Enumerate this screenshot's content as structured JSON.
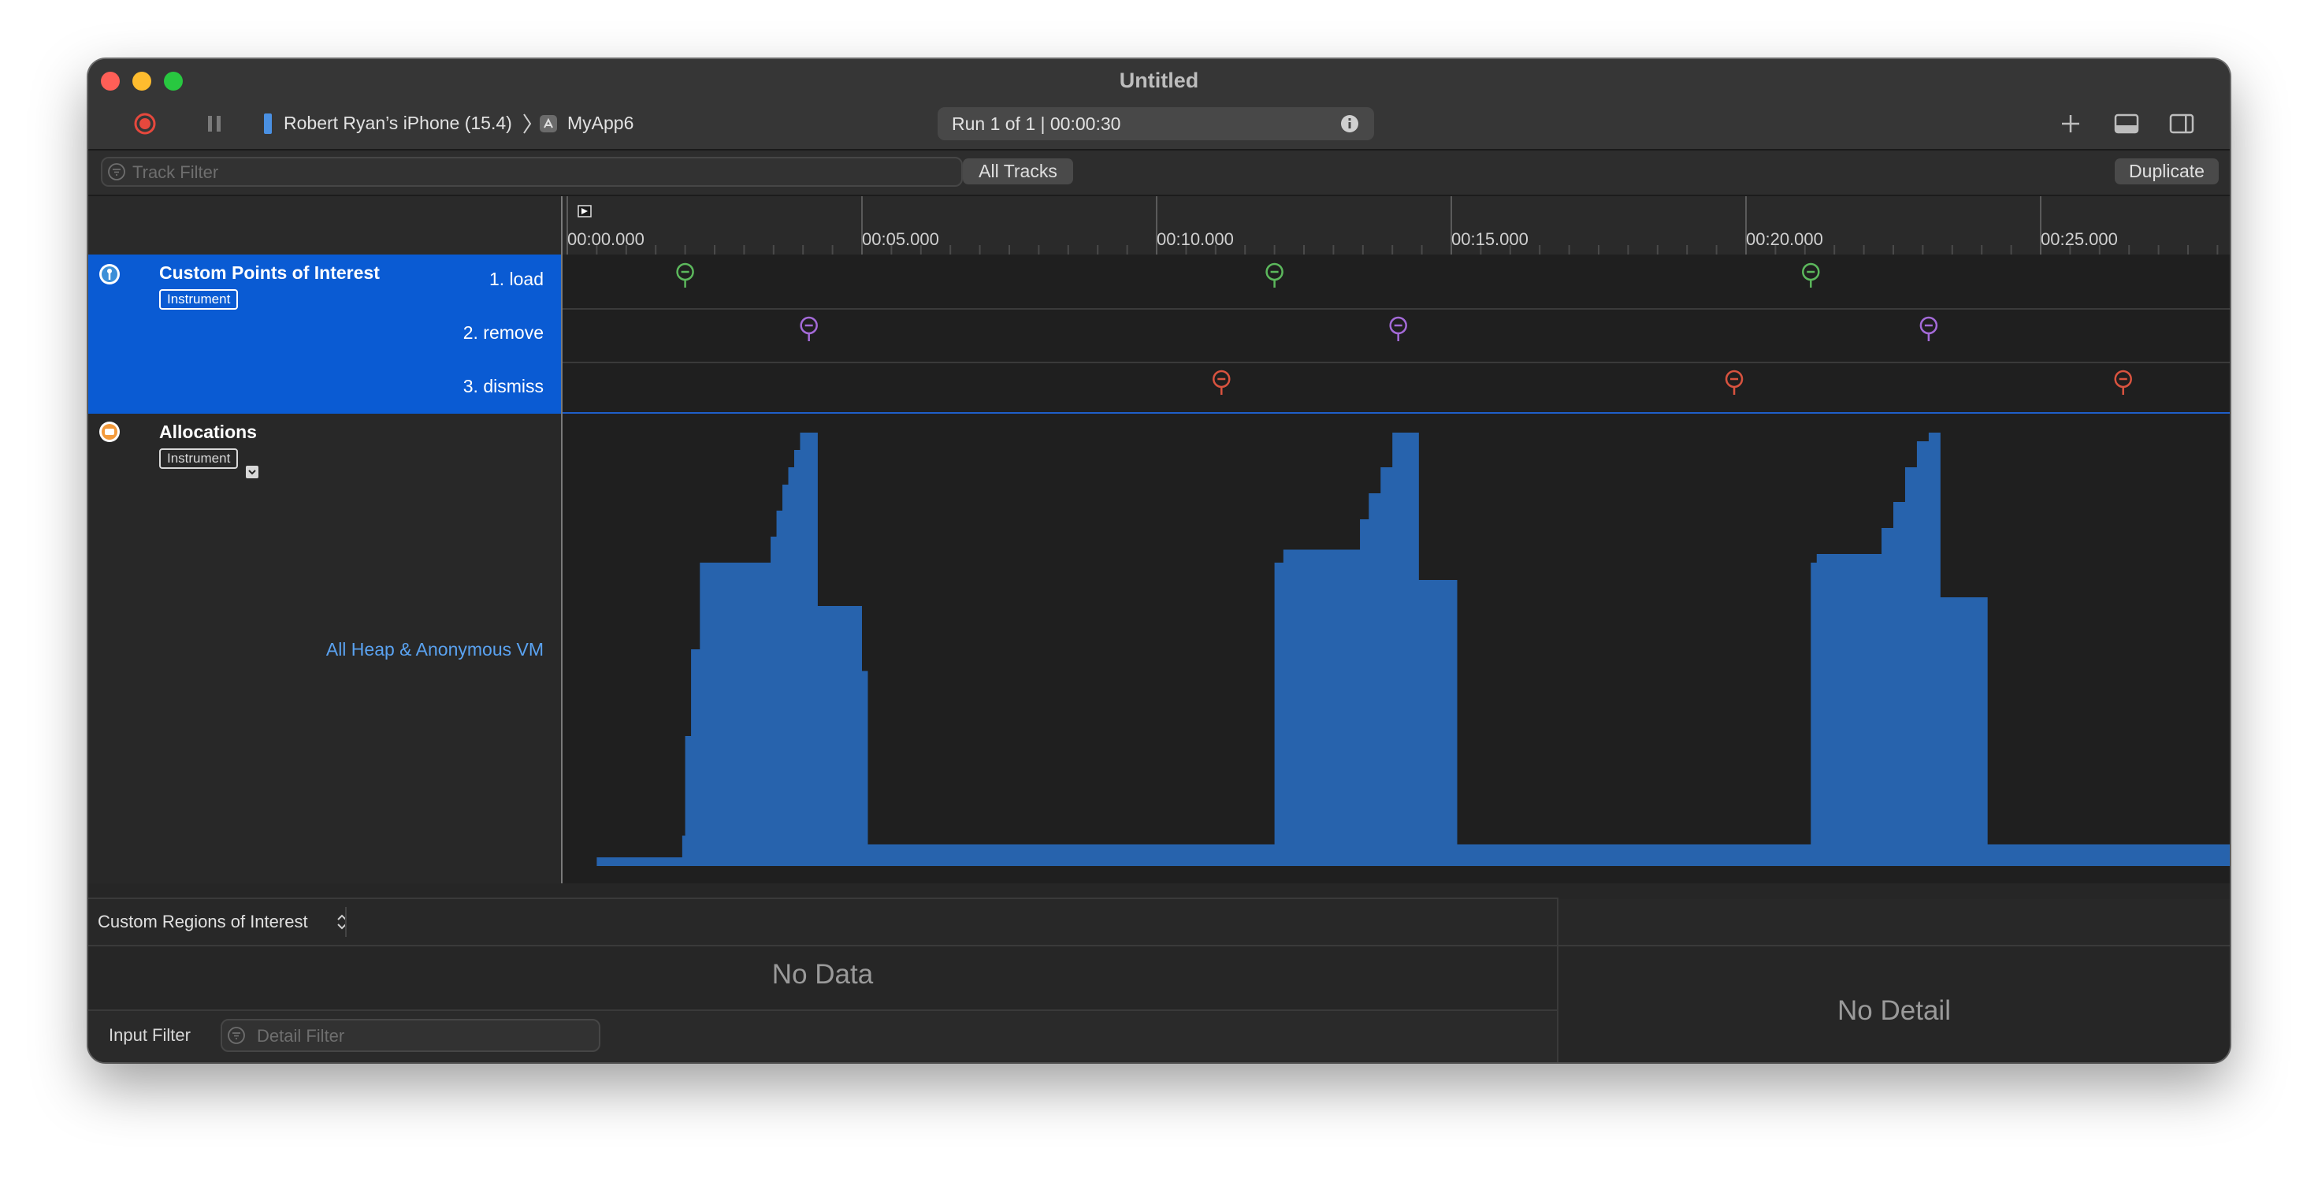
{
  "window": {
    "title": "Untitled"
  },
  "toolbar": {
    "device": "Robert Ryan’s iPhone (15.4)",
    "app": "MyApp6",
    "run": "Run 1 of 1  |  00:00:30",
    "icons": [
      "record-icon",
      "pause-icon",
      "iphone-icon",
      "app-icon",
      "info-icon",
      "plus-icon",
      "bottom-panel-icon",
      "right-panel-icon"
    ]
  },
  "filterbar": {
    "track_filter_placeholder": "Track Filter",
    "all_tracks": "All Tracks",
    "duplicate": "Duplicate"
  },
  "timeline": {
    "ticks": [
      "00:00.000",
      "00:05.000",
      "00:10.000",
      "00:15.000",
      "00:20.000",
      "00:25.000"
    ]
  },
  "tracks": {
    "poi": {
      "name": "Custom Points of Interest",
      "badge": "Instrument",
      "lanes": [
        {
          "label": "1. load",
          "color": "#5cb85c",
          "events_sec": [
            2.0,
            12.0,
            21.1
          ]
        },
        {
          "label": "2. remove",
          "color": "#a46ad8",
          "events_sec": [
            4.1,
            14.1,
            23.1
          ]
        },
        {
          "label": "3. dismiss",
          "color": "#d9533f",
          "events_sec": [
            11.1,
            19.8,
            26.4
          ]
        }
      ]
    },
    "allocations": {
      "name": "Allocations",
      "badge": "Instrument",
      "series_label": "All Heap & Anonymous VM",
      "color": "#2763ad"
    }
  },
  "chart_data": {
    "type": "area",
    "title": "",
    "xlabel": "",
    "ylabel": "",
    "series": [
      {
        "name": "All Heap & Anonymous VM",
        "x": [
          0.5,
          1.95,
          2.0,
          2.1,
          2.25,
          3.35,
          3.45,
          3.55,
          3.65,
          3.75,
          3.85,
          3.95,
          4.15,
          4.25,
          4.9,
          5.0,
          5.1,
          11.9,
          12.0,
          12.15,
          13.3,
          13.45,
          13.6,
          13.8,
          14.0,
          14.45,
          15.0,
          15.1,
          21.0,
          21.1,
          21.2,
          22.15,
          22.3,
          22.5,
          22.7,
          22.9,
          23.1,
          23.3,
          24.0,
          24.1,
          28.3
        ],
        "values": [
          0.02,
          0.07,
          0.3,
          0.5,
          0.7,
          0.7,
          0.76,
          0.82,
          0.88,
          0.92,
          0.96,
          1.0,
          1.0,
          0.6,
          0.6,
          0.45,
          0.05,
          0.05,
          0.7,
          0.73,
          0.73,
          0.8,
          0.86,
          0.92,
          1.0,
          0.66,
          0.66,
          0.05,
          0.05,
          0.7,
          0.72,
          0.72,
          0.78,
          0.84,
          0.92,
          0.98,
          1.0,
          0.62,
          0.62,
          0.05,
          0.05
        ]
      }
    ],
    "xlim": [
      0,
      28.3
    ],
    "grid": false,
    "legend": "none"
  },
  "bottom": {
    "regions_selector": "Custom Regions of Interest",
    "no_data": "No Data",
    "input_filter": "Input Filter",
    "detail_filter_placeholder": "Detail Filter",
    "no_detail": "No Detail"
  }
}
